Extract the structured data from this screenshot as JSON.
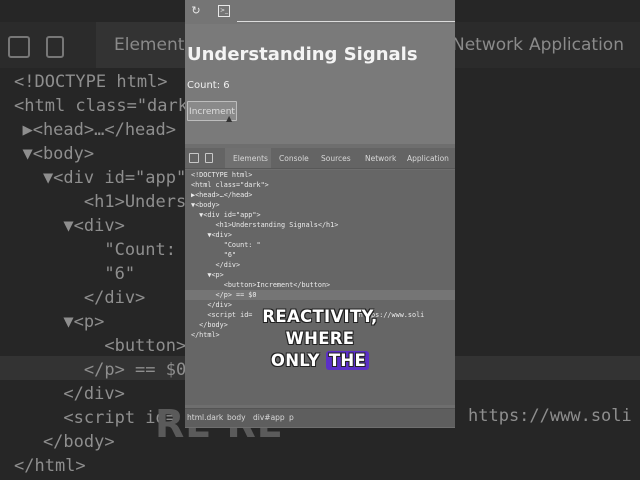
{
  "background": {
    "tabs": [
      "Elements",
      "Network",
      "Application"
    ],
    "code_lines": [
      "<!DOCTYPE html>",
      "<html class=\"dark\">",
      "  ▶<head>…</head>",
      "  ▼<body>",
      "    ▼<div id=\"app\">",
      "        <h1>Understa",
      "      ▼<div>",
      "          \"Count: \"",
      "          \"6\"",
      "        </div>",
      "      ▼<p>",
      "          <button>In",
      "        </p> == $0",
      "      </div>",
      "      <script id=",
      "    </body>",
      "</html>"
    ],
    "big_text": "RE                    RE",
    "url_fragment": "https://www.soli"
  },
  "browser": {
    "reload_icon": "↻",
    "terminal_icon": ">_"
  },
  "page": {
    "title": "Understanding Signals",
    "count_text": "Count: 6",
    "button_label": "Increment"
  },
  "devtools": {
    "tabs": [
      "Elements",
      "Console",
      "Sources",
      "Network",
      "Application"
    ],
    "active_tab": "Elements",
    "code_lines": [
      "<!DOCTYPE html>",
      "<html class=\"dark\">",
      "▶<head>…</head>",
      "▼<body>",
      "  ▼<div id=\"app\">",
      "      <h1>Understanding Signals</h1>",
      "    ▼<div>",
      "        \"Count: \"",
      "        \"6\"",
      "      </div>",
      "    ▼<p>",
      "        <button>Increment</button>",
      "      </p> == $0",
      "    </div>",
      "    <script id=                          https://www.soli",
      "  </body>",
      "</html>"
    ],
    "breadcrumbs": [
      "html.dark",
      "body",
      "div#app",
      "p"
    ]
  },
  "caption": {
    "line1": "REACTIVITY, WHERE",
    "line2_pre": "ONLY ",
    "line2_highlight": "THE",
    "highlight_color": "#5b2fc7"
  }
}
